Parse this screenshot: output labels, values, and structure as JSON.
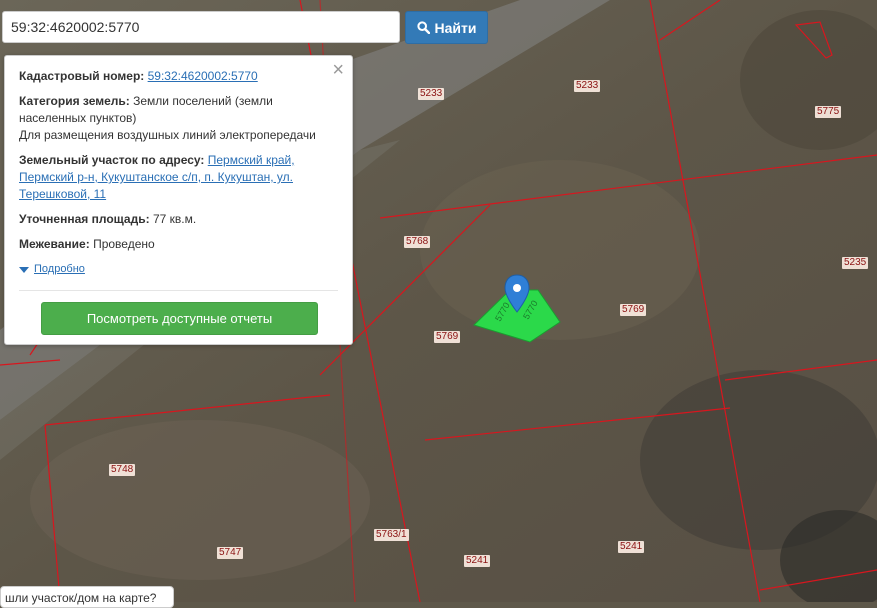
{
  "search": {
    "value": "59:32:4620002:5770",
    "button_label": "Найти"
  },
  "popup": {
    "cadastral_label": "Кадастровый номер:",
    "cadastral_value": "59:32:4620002:5770",
    "category_label": "Категория земель:",
    "category_value": "Земли поселений (земли населенных пунктов)",
    "category_purpose": "Для размещения воздушных линий электропередачи",
    "address_label": "Земельный участок по адресу:",
    "address_value": "Пермский край, Пермский р-н, Кукуштанское с/п, п. Кукуштан, ул. Терешковой, 11",
    "area_label": "Уточненная площадь:",
    "area_value": "77 кв.м.",
    "survey_label": "Межевание:",
    "survey_value": "Проведено",
    "details_label": "Подробно",
    "reports_button": "Посмотреть доступные отчеты",
    "close_symbol": "×"
  },
  "map": {
    "plot_labels": [
      "5233",
      "5233",
      "5775",
      "5768",
      "5235",
      "5769",
      "5769",
      "5748",
      "5747",
      "5763/1",
      "5241",
      "5241"
    ],
    "highlighted_plot_label": "5770",
    "colors": {
      "boundary": "#d8161e",
      "highlight": "#2bd94a",
      "marker": "#2f7fd6"
    }
  },
  "help": {
    "text": "шли участок/дом на карте?"
  }
}
